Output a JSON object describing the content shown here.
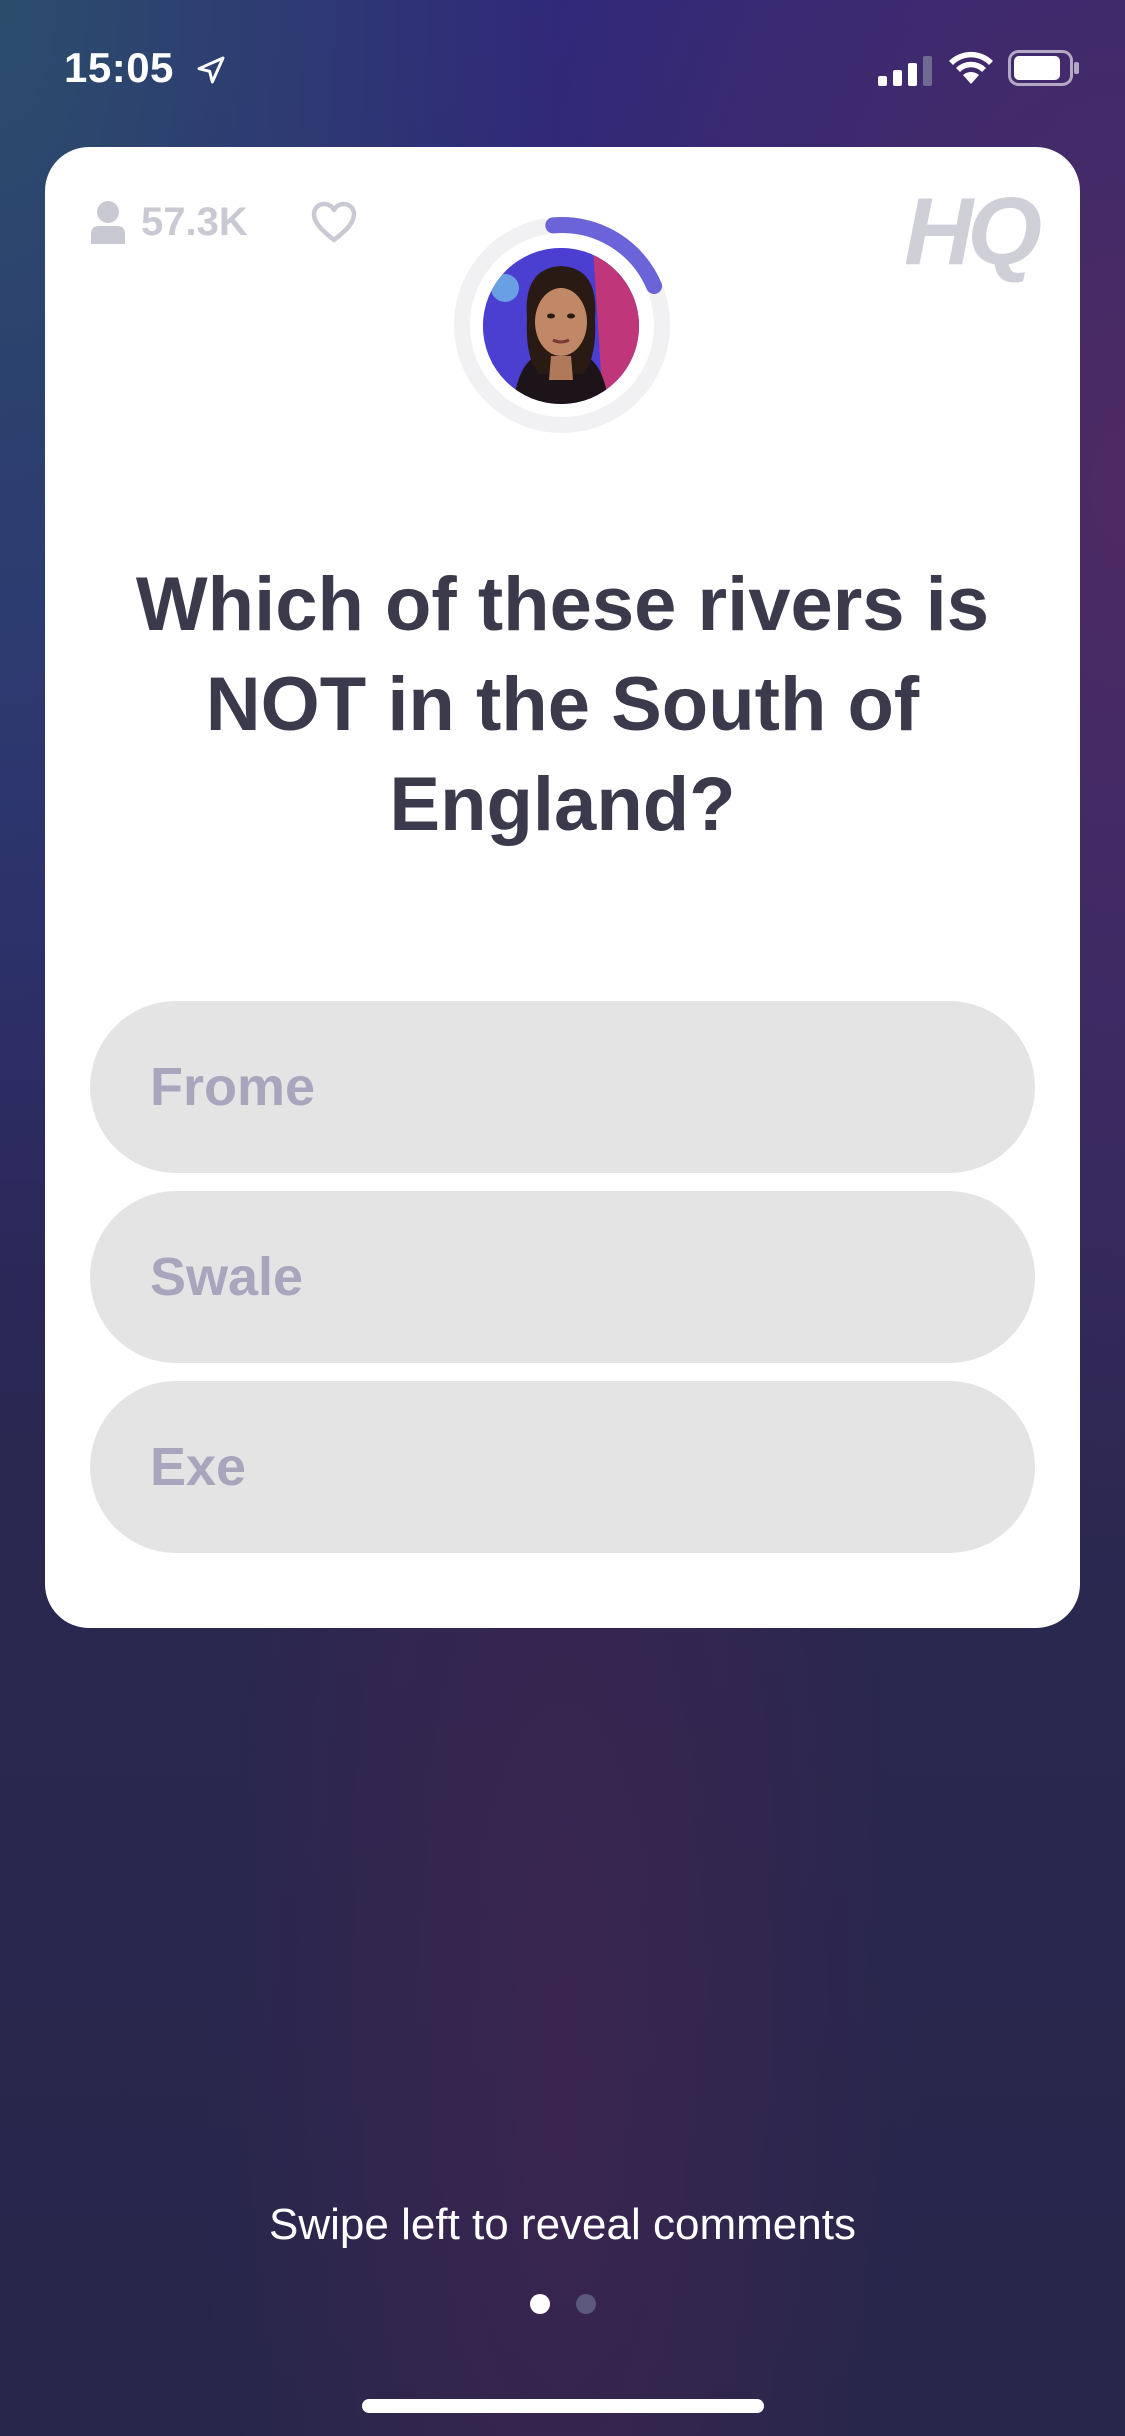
{
  "status_bar": {
    "time": "15:05",
    "icons": [
      "location-arrow-icon",
      "signal-icon",
      "wifi-icon",
      "battery-icon"
    ]
  },
  "game": {
    "viewer_count": "57.3K",
    "logo": "HQ",
    "timer_progress": 0.2,
    "question": "Which of these rivers is NOT in the South of England?",
    "answers": [
      {
        "label": "Frome"
      },
      {
        "label": "Swale"
      },
      {
        "label": "Exe"
      }
    ]
  },
  "footer": {
    "swipe_hint": "Swipe left to reveal comments",
    "page_index": 0,
    "page_count": 2
  },
  "colors": {
    "accent": "#6b63d8",
    "answer_bg": "#e4e4e4",
    "answer_text": "#a8a5bd",
    "question_text": "#3a3a4c"
  }
}
